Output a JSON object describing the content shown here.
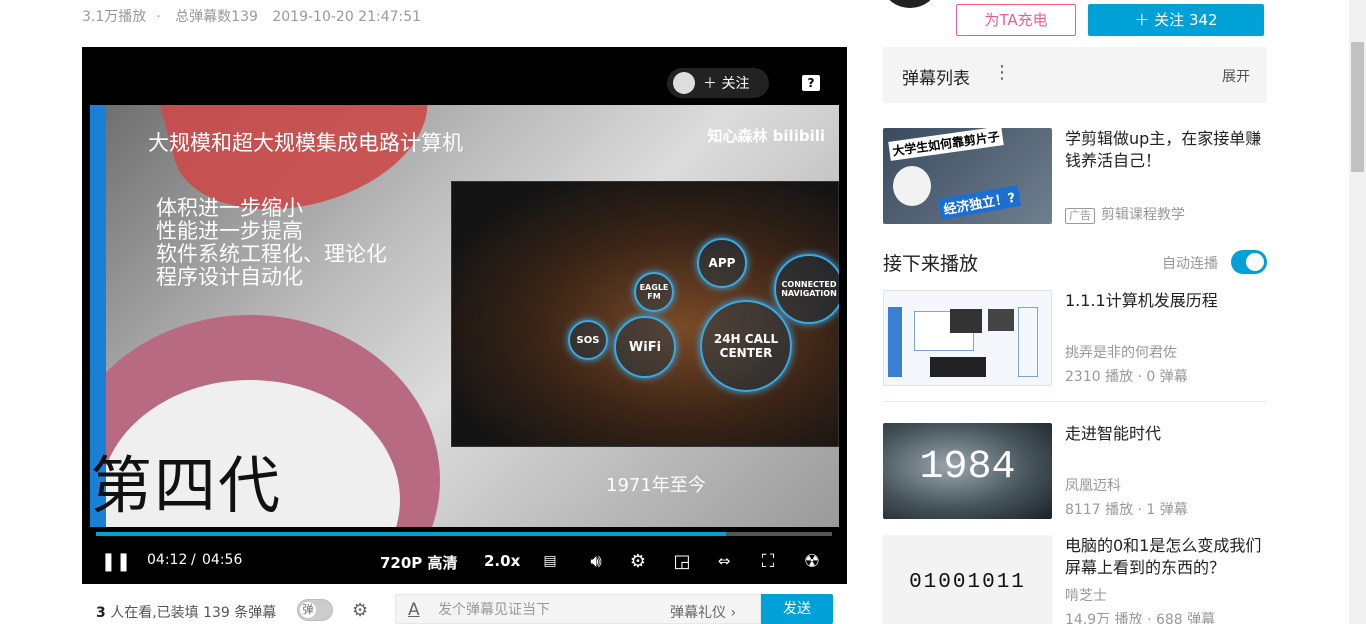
{
  "meta": {
    "plays": "3.1万播放",
    "sep": "·",
    "danmaku_total": "总弹幕数139",
    "datetime": "2019-10-20 21:47:51"
  },
  "player": {
    "follow_pill": "关注",
    "help": "?",
    "slide_title": "大规模和超大规模集成电路计算机",
    "logo_text": "知心森林 bilibili",
    "bullets": [
      "体积进一步缩小",
      "性能进一步提高",
      "软件系统工程化、理论化",
      "程序设计自动化"
    ],
    "generation": "第四代",
    "year": "1971年至今",
    "badges": [
      "APP",
      "WiFi",
      "SOS",
      "24H CALL CENTER",
      "CONNECTED NAVIGATION",
      "EAGLE FM"
    ],
    "progress": 0.856,
    "time_current": "04:12",
    "time_sep": "/",
    "time_total": "04:56",
    "quality": "720P 高清",
    "speed": "2.0x"
  },
  "danmaku_bar": {
    "count_prefix": "3",
    "count_text": " 人在看,已装填 139 条弹幕",
    "toggle_label": "弹",
    "input_placeholder": "发个弹幕见证当下",
    "etiquette": "弹幕礼仪 ›",
    "send": "发送"
  },
  "sidebar": {
    "charge": "为TA充电",
    "follow": "＋ 关注 342",
    "danmaku_list_title": "弹幕列表",
    "expand": "展开",
    "ad": {
      "title": "学剪辑做up主，在家接单赚钱养活自己！",
      "tag": "广告",
      "owner": "剪辑课程教学",
      "thumb_top": "大学生如何靠剪片子",
      "thumb_bottom": "经济独立！?"
    },
    "next_label": "接下来播放",
    "autoplay_label": "自动连播",
    "autoplay_on": true,
    "videos": [
      {
        "title": "1.1.1计算机发展历程",
        "owner": "挑弄是非的何君佐",
        "stats": "2310 播放 · 0 弹幕"
      },
      {
        "title": "走进智能时代",
        "owner": "凤凰迈科",
        "stats": "8117 播放 · 1 弹幕",
        "thumb_text": "1984"
      },
      {
        "title": "电脑的0和1是怎么变成我们屏幕上看到的东西的？",
        "owner": "啃芝士",
        "stats": "14.9万 播放 · 688 弹幕",
        "thumb_text": "01001011"
      }
    ]
  },
  "colors": {
    "accent": "#00a1d6",
    "charge": "#f25d8e"
  }
}
